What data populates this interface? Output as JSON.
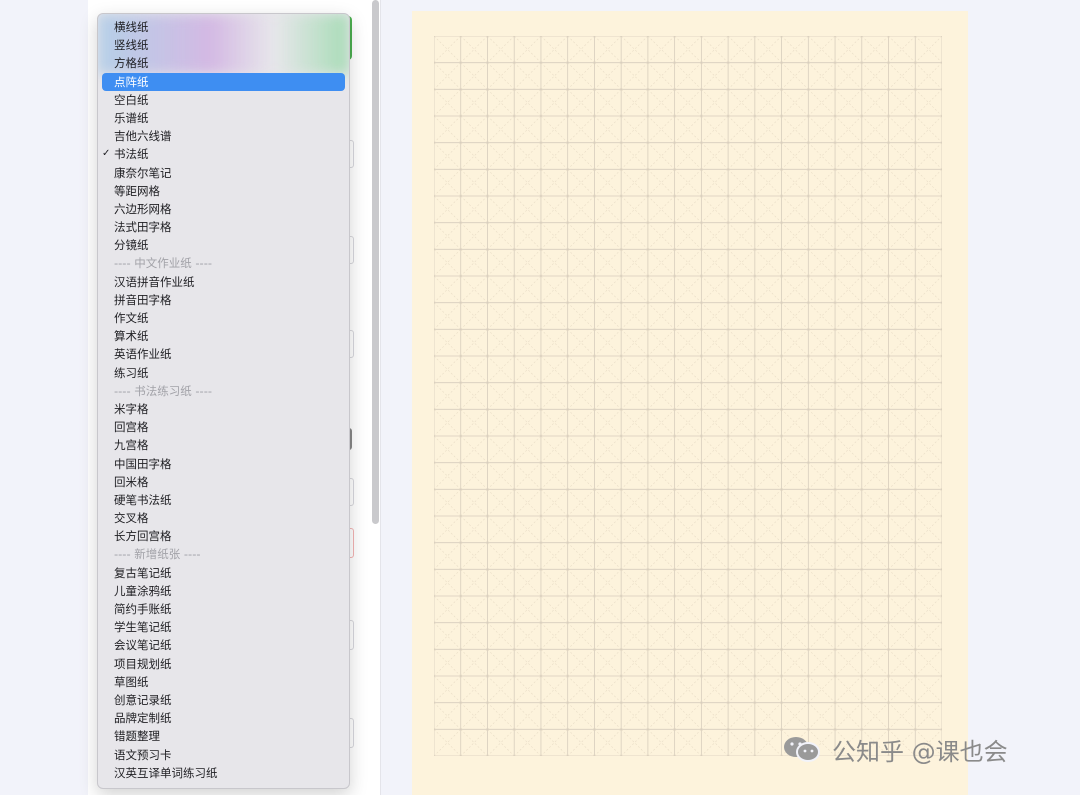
{
  "paper_menu": {
    "items": [
      {
        "label": "横线纸"
      },
      {
        "label": "竖线纸"
      },
      {
        "label": "方格纸"
      },
      {
        "label": "点阵纸",
        "highlighted": true
      },
      {
        "label": "空白纸"
      },
      {
        "label": "乐谱纸"
      },
      {
        "label": "吉他六线谱"
      },
      {
        "label": "书法纸",
        "checked": true
      },
      {
        "label": "康奈尔笔记"
      },
      {
        "label": "等距网格"
      },
      {
        "label": "六边形网格"
      },
      {
        "label": "法式田字格"
      },
      {
        "label": "分镜纸"
      },
      {
        "label": "---- 中文作业纸 ----",
        "separator": true
      },
      {
        "label": "汉语拼音作业纸"
      },
      {
        "label": "拼音田字格"
      },
      {
        "label": "作文纸"
      },
      {
        "label": "算术纸"
      },
      {
        "label": "英语作业纸"
      },
      {
        "label": "练习纸"
      },
      {
        "label": "---- 书法练习纸 ----",
        "separator": true
      },
      {
        "label": "米字格"
      },
      {
        "label": "回宫格"
      },
      {
        "label": "九宫格"
      },
      {
        "label": "中国田字格"
      },
      {
        "label": "回米格"
      },
      {
        "label": "硬笔书法纸"
      },
      {
        "label": "交叉格"
      },
      {
        "label": "长方回宫格"
      },
      {
        "label": "---- 新增纸张 ----",
        "separator": true
      },
      {
        "label": "复古笔记纸"
      },
      {
        "label": "儿童涂鸦纸"
      },
      {
        "label": "简约手账纸"
      },
      {
        "label": "学生笔记纸"
      },
      {
        "label": "会议笔记纸"
      },
      {
        "label": "项目规划纸"
      },
      {
        "label": "草图纸"
      },
      {
        "label": "创意记录纸"
      },
      {
        "label": "品牌定制纸"
      },
      {
        "label": "错题整理"
      },
      {
        "label": "语文预习卡"
      },
      {
        "label": "汉英互译单词练习纸"
      }
    ]
  },
  "preview": {
    "columns": 19,
    "rows": 27,
    "paper_color": "#fdf3dc",
    "line_color": "#d7cdbd",
    "diagonal_color": "#e8dcc6"
  },
  "watermark": {
    "text": "公知乎 @课也会",
    "icon": "wechat-icon"
  },
  "colors": {
    "selection": "#3e8ef2",
    "accent_green": "#4caf50"
  }
}
